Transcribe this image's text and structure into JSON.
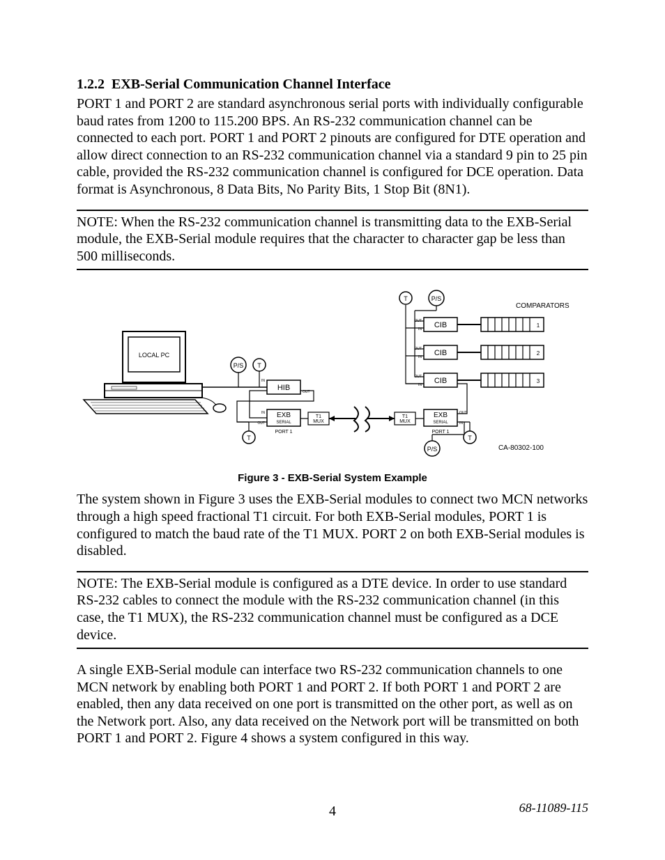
{
  "heading_number": "1.2.2",
  "heading_text": "EXB-Serial Communication Channel Interface",
  "para1": "PORT 1 and PORT 2 are standard asynchronous serial ports with individually configurable baud rates from 1200 to 115.200 BPS.  An RS-232 communication channel can be connected to each port.  PORT 1 and PORT 2 pinouts are configured for DTE operation and allow direct connection to an RS-232 communication channel via a standard 9 pin to 25 pin cable, provided the RS-232 communication channel is configured for DCE operation.  Data format is Asynchronous, 8 Data Bits, No Parity Bits, 1 Stop Bit (8N1).",
  "note1": "NOTE:  When the RS-232 communication channel is transmitting data to the EXB-Serial module, the EXB-Serial module requires that the character to character gap be less than 500 milliseconds.",
  "figure_caption": "Figure 3 - EXB-Serial System Example",
  "diagram": {
    "local_pc": "LOCAL PC",
    "hib": "HIB",
    "exb": "EXB",
    "serial": "SERIAL",
    "cib": "CIB",
    "t1_mux_a": "T1",
    "t1_mux_b": "MUX",
    "port1": "PORT 1",
    "comparators": "COMPARATORS",
    "in": "IN",
    "out": "OUT",
    "t": "T",
    "ps": "P/S",
    "partno": "CA-80302-100",
    "idx1": "1",
    "idx2": "2",
    "idx3": "3"
  },
  "para2": "The system shown in Figure 3 uses the EXB-Serial modules to connect two MCN networks through a high speed fractional T1 circuit.  For both EXB-Serial modules, PORT 1 is configured to match the baud rate of the T1 MUX.  PORT 2 on both EXB-Serial modules is disabled.",
  "note2": "NOTE:  The EXB-Serial module is configured as a DTE device.  In order to use standard RS-232 cables to connect the module with the RS-232 communication channel (in this case, the T1 MUX), the RS-232 communication channel must be configured as a DCE device.",
  "para3": "A single EXB-Serial module can interface two RS-232 communication channels to one MCN network by enabling both PORT 1 and PORT 2.  If both PORT 1 and PORT 2 are enabled, then any data received on one port is transmitted on the other port, as well as on the Network port. Also, any data received on the Network port will be transmitted on both PORT 1 and PORT 2. Figure 4 shows a system configured in this way.",
  "doc_number": "68-11089-115",
  "page_number": "4"
}
